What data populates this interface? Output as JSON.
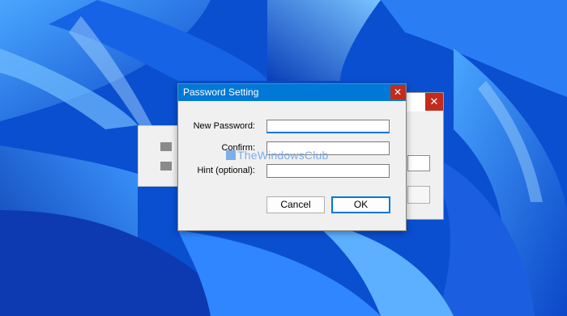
{
  "wallpaper": {
    "base_color": "#0a4fd0",
    "highlight_color": "#5aa8ff"
  },
  "dialog": {
    "title": "Password Setting",
    "close_glyph": "✕",
    "fields": {
      "new_password": {
        "label": "New Password:",
        "value": ""
      },
      "confirm": {
        "label": "Confirm:",
        "value": ""
      },
      "hint": {
        "label": "Hint (optional):",
        "value": ""
      }
    },
    "buttons": {
      "cancel": "Cancel",
      "ok": "OK"
    },
    "accent_color": "#0078d7",
    "close_color": "#c42b1c"
  },
  "background_window": {
    "close_glyph": "✕"
  },
  "watermark": {
    "text": "TheWindowsClub"
  }
}
